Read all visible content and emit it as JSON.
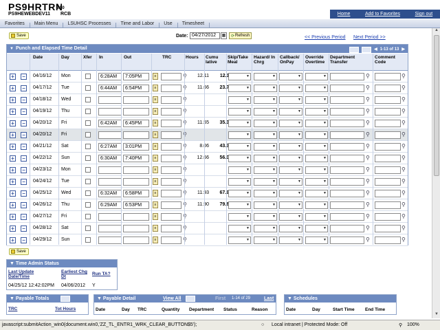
{
  "header": {
    "app_title": "PS9HRTRN",
    "version": "8.50",
    "db_name": "PS9HEWEBDEV11",
    "user_id": "RCB",
    "links": [
      "Home",
      "Add to Favorites",
      "Sign out"
    ]
  },
  "breadcrumb": [
    "Favorites",
    "Main Menu",
    "LSUHSC Processes",
    "Time and Labor",
    "Use",
    "Timesheet"
  ],
  "toolbar": {
    "save_label": "Save",
    "date_label": "Date:",
    "date_value": "04/27/2012",
    "refresh_label": "Refresh",
    "prev_period": "<< Previous Period",
    "next_period": "Next Period >>"
  },
  "grid": {
    "title": "Punch and Elapsed Time Detail",
    "range": "1-13 of 13",
    "columns": [
      "Date",
      "Day",
      "Xfer",
      "In",
      "Out",
      "TRC",
      "Hours",
      "Cumu lative",
      "Skip/Take Meal",
      "Hazard/ In Chrg",
      "Callback/ OnPay",
      "Override Overtime",
      "Department Transfer",
      "Comment Code"
    ],
    "rows": [
      {
        "date": "04/16/12",
        "day": "Mon",
        "in": "6:28AM",
        "out": "7:05PM",
        "hours": "12.11",
        "cumulative": "12.11"
      },
      {
        "date": "04/17/12",
        "day": "Tue",
        "in": "6:44AM",
        "out": "6:54PM",
        "hours": "11.66",
        "cumulative": "23.77"
      },
      {
        "date": "04/18/12",
        "day": "Wed",
        "in": "",
        "out": "",
        "hours": "",
        "cumulative": ""
      },
      {
        "date": "04/19/12",
        "day": "Thu",
        "in": "",
        "out": "",
        "hours": "",
        "cumulative": ""
      },
      {
        "date": "04/20/12",
        "day": "Fri",
        "in": "6:42AM",
        "out": "6:45PM",
        "hours": "11.55",
        "cumulative": "35.32"
      },
      {
        "date": "04/20/12",
        "day": "Fri",
        "in": "",
        "out": "",
        "hours": "",
        "cumulative": ""
      },
      {
        "date": "04/21/12",
        "day": "Sat",
        "in": "6:27AM",
        "out": "3:01PM",
        "hours": "8.06",
        "cumulative": "43.38"
      },
      {
        "date": "04/22/12",
        "day": "Sun",
        "in": "6:30AM",
        "out": "7:40PM",
        "hours": "12.66",
        "cumulative": "56.04"
      },
      {
        "date": "04/23/12",
        "day": "Mon",
        "in": "",
        "out": "",
        "hours": "",
        "cumulative": ""
      },
      {
        "date": "04/24/12",
        "day": "Tue",
        "in": "",
        "out": "",
        "hours": "",
        "cumulative": ""
      },
      {
        "date": "04/25/12",
        "day": "Wed",
        "in": "6:32AM",
        "out": "6:58PM",
        "hours": "11.93",
        "cumulative": "67.97"
      },
      {
        "date": "04/26/12",
        "day": "Thu",
        "in": "6:29AM",
        "out": "6:53PM",
        "hours": "11.90",
        "cumulative": "79.87"
      },
      {
        "date": "04/27/12",
        "day": "Fri",
        "in": "",
        "out": "",
        "hours": "",
        "cumulative": ""
      },
      {
        "date": "04/28/12",
        "day": "Sat",
        "in": "",
        "out": "",
        "hours": "",
        "cumulative": ""
      },
      {
        "date": "04/29/12",
        "day": "Sun",
        "in": "",
        "out": "",
        "hours": "",
        "cumulative": ""
      }
    ]
  },
  "time_admin": {
    "title": "Time Admin Status",
    "headers": [
      "Last Update Date/Time",
      "Earliest Chg Dt",
      "Run TA?"
    ],
    "values": [
      "04/25/12 12:42:02PM",
      "04/06/2012",
      "Y"
    ]
  },
  "payable_totals": {
    "title": "Payable Totals",
    "headers": [
      "TRC",
      "Tot Hours"
    ]
  },
  "payable_detail": {
    "title": "Payable Detail",
    "view_all": "View All",
    "first": "First",
    "range": "1-14 of 29",
    "last": "Last",
    "headers": [
      "Date",
      "Day",
      "TRC",
      "Quantity",
      "Department",
      "Status",
      "Reason"
    ]
  },
  "schedules": {
    "title": "Schedules",
    "headers": [
      "Date",
      "Day",
      "Start Time",
      "End Time"
    ]
  },
  "statusbar": {
    "url": "javascript:submitAction_win0(document.win0,'ZZ_TL_ENTR1_WRK_CLEAR_BUTTON$5');",
    "zone": "Local intranet | Protected Mode: Off",
    "zoom": "100%"
  }
}
